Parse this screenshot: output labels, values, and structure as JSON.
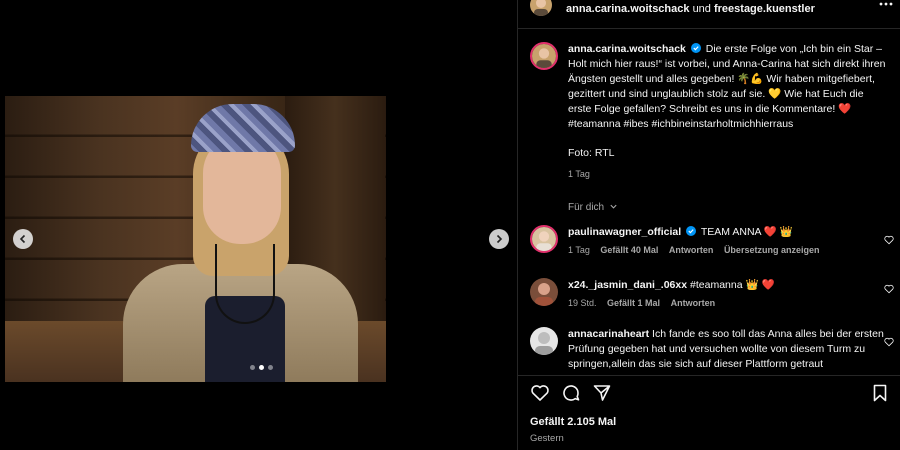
{
  "post": {
    "header": {
      "author": "anna.carina.woitschack",
      "connector": "und",
      "collaborator": "freestage.kuenstler"
    },
    "media": {
      "description_icon": "photo-of-woman-in-bandana",
      "slide_count": 3,
      "active_slide": 2
    },
    "caption": {
      "username": "anna.carina.woitschack",
      "verified": true,
      "text": "Die erste Folge von „Ich bin ein Star – Holt mich hier raus!“ ist vorbei, und Anna-Carina hat sich direkt ihren Ängsten gestellt und alles gegeben! 🌴💪 Wir haben mitgefiebert, gezittert und sind unglaublich stolz auf sie. 💛 Wie hat Euch die erste Folge gefallen? Schreibt es uns in die Kommentare! ❤️ #teamanna #ibes #ichbineinstarholtmichhierraus",
      "credit": "Foto: RTL",
      "age": "1 Tag",
      "translation_label": "Für dich"
    },
    "comments": [
      {
        "username": "paulinawagner_official",
        "verified": true,
        "text": "TEAM ANNA ❤️ 👑",
        "age": "1 Tag",
        "likes": "Gefällt 40 Mal",
        "reply": "Antworten",
        "translate": "Übersetzung anzeigen"
      },
      {
        "username": "x24._jasmin_dani_.06xx",
        "verified": false,
        "text": "#teamanna 👑 ❤️",
        "age": "19 Std.",
        "likes": "Gefällt 1 Mal",
        "reply": "Antworten"
      },
      {
        "username": "annacarinaheart",
        "verified": false,
        "text": "Ich fande es soo toll das Anna alles bei der ersten Prüfung gegeben hat und versuchen wollte von diesem Turm zu springen,allein das sie sich auf dieser Plattform getraut"
      }
    ],
    "likes": "Gefällt 2.105 Mal",
    "timestamp": "Gestern"
  },
  "colors": {
    "background": "#000000",
    "divider": "#262626",
    "muted_text": "#a8a8a8",
    "verified": "#0095f6",
    "story_ring": "#e1306c"
  }
}
